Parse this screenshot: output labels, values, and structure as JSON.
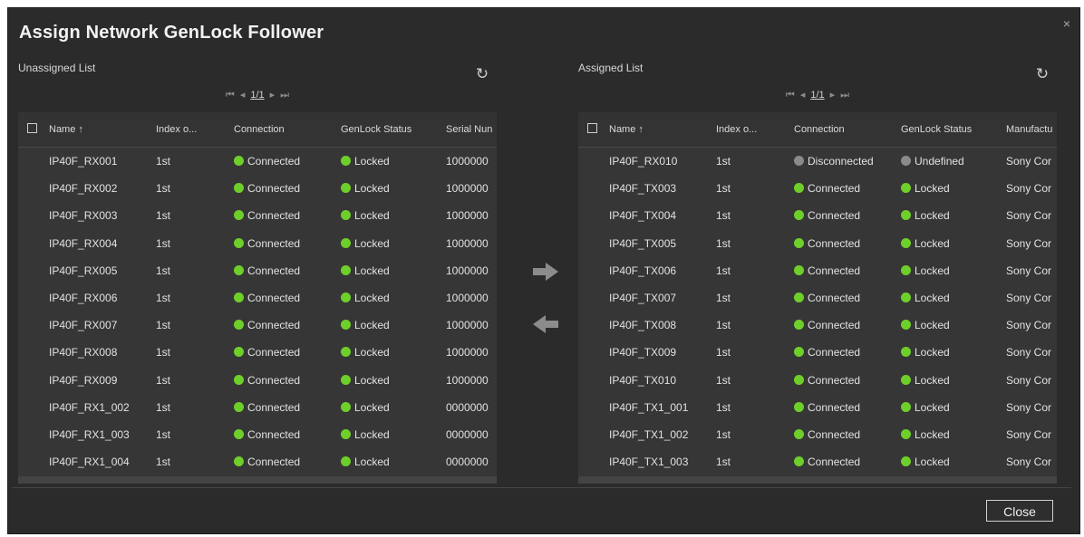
{
  "dialog": {
    "title": "Assign Network GenLock Follower",
    "close_icon": "×",
    "close_label": "Close"
  },
  "colors": {
    "connected": "#6fcf2a",
    "disconnected": "#8a8a8a",
    "background": "#2b2b2b"
  },
  "icons": {
    "refresh": "refresh-icon",
    "move_right": "arrow-right-icon",
    "move_left": "arrow-left-icon"
  },
  "unassigned": {
    "label": "Unassigned List",
    "refresh_glyph": "↻",
    "pager": {
      "first": "⏮",
      "prev": "◂",
      "page": "1/1",
      "next": "▸",
      "last": "⏭"
    },
    "columns": [
      "Name ↑",
      "Index o...",
      "Connection",
      "GenLock Status",
      "Serial Nun"
    ],
    "rows": [
      {
        "name": "IP40F_RX001",
        "index": "1st",
        "connection": "Connected",
        "genlock": "Locked",
        "extra": "1000000"
      },
      {
        "name": "IP40F_RX002",
        "index": "1st",
        "connection": "Connected",
        "genlock": "Locked",
        "extra": "1000000"
      },
      {
        "name": "IP40F_RX003",
        "index": "1st",
        "connection": "Connected",
        "genlock": "Locked",
        "extra": "1000000"
      },
      {
        "name": "IP40F_RX004",
        "index": "1st",
        "connection": "Connected",
        "genlock": "Locked",
        "extra": "1000000"
      },
      {
        "name": "IP40F_RX005",
        "index": "1st",
        "connection": "Connected",
        "genlock": "Locked",
        "extra": "1000000"
      },
      {
        "name": "IP40F_RX006",
        "index": "1st",
        "connection": "Connected",
        "genlock": "Locked",
        "extra": "1000000"
      },
      {
        "name": "IP40F_RX007",
        "index": "1st",
        "connection": "Connected",
        "genlock": "Locked",
        "extra": "1000000"
      },
      {
        "name": "IP40F_RX008",
        "index": "1st",
        "connection": "Connected",
        "genlock": "Locked",
        "extra": "1000000"
      },
      {
        "name": "IP40F_RX009",
        "index": "1st",
        "connection": "Connected",
        "genlock": "Locked",
        "extra": "1000000"
      },
      {
        "name": "IP40F_RX1_002",
        "index": "1st",
        "connection": "Connected",
        "genlock": "Locked",
        "extra": "0000000"
      },
      {
        "name": "IP40F_RX1_003",
        "index": "1st",
        "connection": "Connected",
        "genlock": "Locked",
        "extra": "0000000"
      },
      {
        "name": "IP40F_RX1_004",
        "index": "1st",
        "connection": "Connected",
        "genlock": "Locked",
        "extra": "0000000"
      }
    ]
  },
  "assigned": {
    "label": "Assigned List",
    "refresh_glyph": "↻",
    "pager": {
      "first": "⏮",
      "prev": "◂",
      "page": "1/1",
      "next": "▸",
      "last": "⏭"
    },
    "columns": [
      "Name ↑",
      "Index o...",
      "Connection",
      "GenLock Status",
      "Manufactu"
    ],
    "rows": [
      {
        "name": "IP40F_RX010",
        "index": "1st",
        "connection": "Disconnected",
        "genlock": "Undefined",
        "extra": "Sony Cor"
      },
      {
        "name": "IP40F_TX003",
        "index": "1st",
        "connection": "Connected",
        "genlock": "Locked",
        "extra": "Sony Cor"
      },
      {
        "name": "IP40F_TX004",
        "index": "1st",
        "connection": "Connected",
        "genlock": "Locked",
        "extra": "Sony Cor"
      },
      {
        "name": "IP40F_TX005",
        "index": "1st",
        "connection": "Connected",
        "genlock": "Locked",
        "extra": "Sony Cor"
      },
      {
        "name": "IP40F_TX006",
        "index": "1st",
        "connection": "Connected",
        "genlock": "Locked",
        "extra": "Sony Cor"
      },
      {
        "name": "IP40F_TX007",
        "index": "1st",
        "connection": "Connected",
        "genlock": "Locked",
        "extra": "Sony Cor"
      },
      {
        "name": "IP40F_TX008",
        "index": "1st",
        "connection": "Connected",
        "genlock": "Locked",
        "extra": "Sony Cor"
      },
      {
        "name": "IP40F_TX009",
        "index": "1st",
        "connection": "Connected",
        "genlock": "Locked",
        "extra": "Sony Cor"
      },
      {
        "name": "IP40F_TX010",
        "index": "1st",
        "connection": "Connected",
        "genlock": "Locked",
        "extra": "Sony Cor"
      },
      {
        "name": "IP40F_TX1_001",
        "index": "1st",
        "connection": "Connected",
        "genlock": "Locked",
        "extra": "Sony Cor"
      },
      {
        "name": "IP40F_TX1_002",
        "index": "1st",
        "connection": "Connected",
        "genlock": "Locked",
        "extra": "Sony Cor"
      },
      {
        "name": "IP40F_TX1_003",
        "index": "1st",
        "connection": "Connected",
        "genlock": "Locked",
        "extra": "Sony Cor"
      }
    ]
  }
}
